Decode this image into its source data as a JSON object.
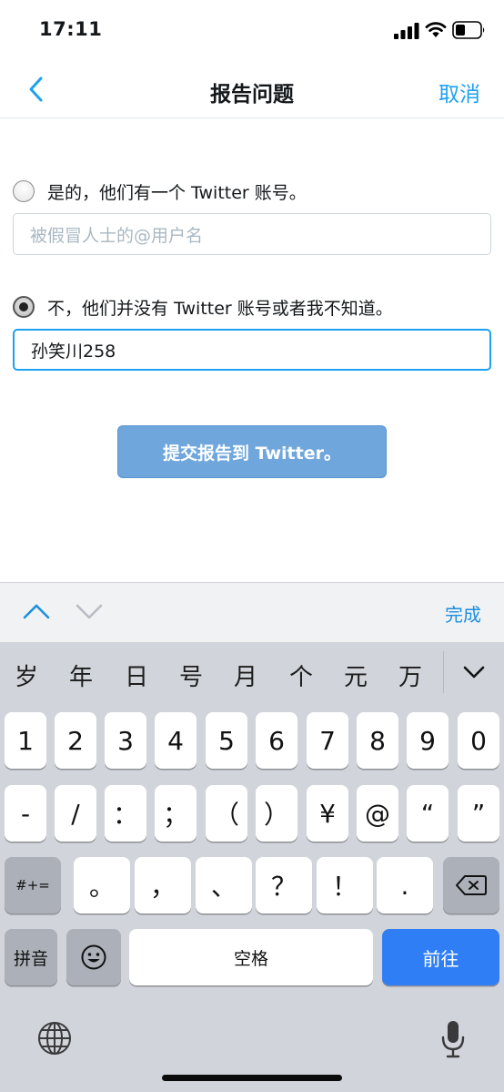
{
  "status_bar": {
    "time": "17:11"
  },
  "nav": {
    "title": "报告问题",
    "cancel": "取消"
  },
  "form": {
    "option_yes": "是的，他们有一个 Twitter 账号。",
    "username_placeholder": "被假冒人士的@用户名",
    "option_no": "不，他们并没有 Twitter 账号或者我不知道。",
    "name_value": "孙笑川258",
    "submit": "提交报告到 Twitter。",
    "selected_option": "no"
  },
  "accessory": {
    "done": "完成"
  },
  "keyboard": {
    "candidates": [
      "岁",
      "年",
      "日",
      "号",
      "月",
      "个",
      "元",
      "万"
    ],
    "row1": [
      "1",
      "2",
      "3",
      "4",
      "5",
      "6",
      "7",
      "8",
      "9",
      "0"
    ],
    "row2": [
      "-",
      "/",
      "：",
      "；",
      "（",
      "）",
      "¥",
      "@",
      "“",
      "”"
    ],
    "row3_symbol": "#+=",
    "row3": [
      "。",
      "，",
      "、",
      "？",
      "！",
      "."
    ],
    "pinyin": "拼音",
    "space": "空格",
    "go": "前往",
    "accent_color": "#2f7ef6"
  }
}
